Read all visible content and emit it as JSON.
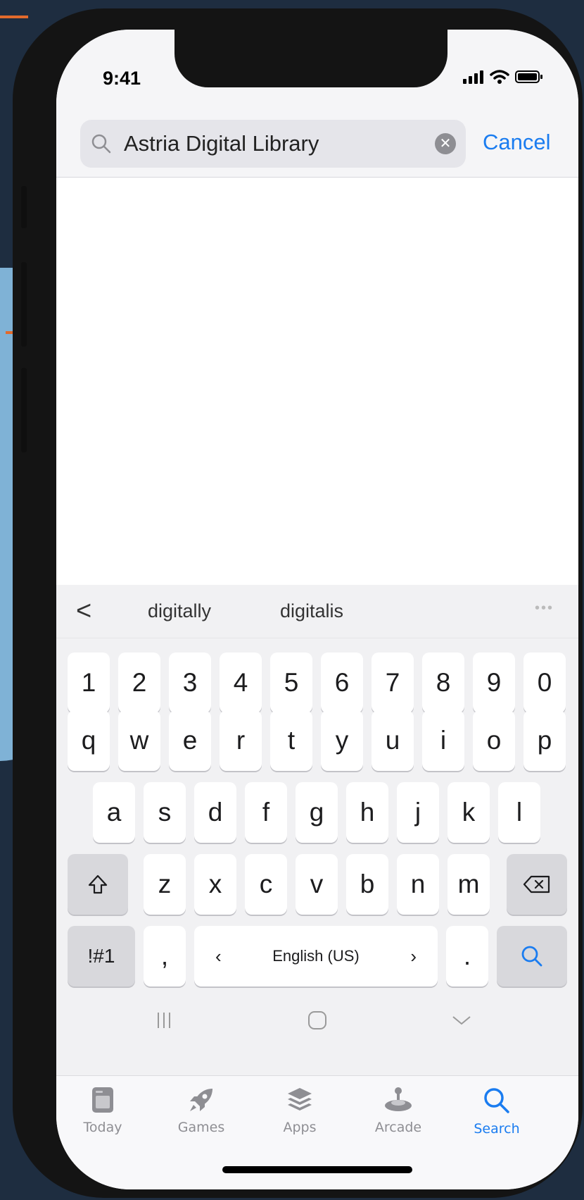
{
  "status": {
    "time": "9:41"
  },
  "search": {
    "query": "Astria Digital Library",
    "cancel_label": "Cancel"
  },
  "keyboard": {
    "suggestions": [
      "digitally",
      "digitalis"
    ],
    "number_row": [
      "1",
      "2",
      "3",
      "4",
      "5",
      "6",
      "7",
      "8",
      "9",
      "0"
    ],
    "row1": [
      "q",
      "w",
      "e",
      "r",
      "t",
      "y",
      "u",
      "i",
      "o",
      "p"
    ],
    "row2": [
      "a",
      "s",
      "d",
      "f",
      "g",
      "h",
      "j",
      "k",
      "l"
    ],
    "row3": [
      "z",
      "x",
      "c",
      "v",
      "b",
      "n",
      "m"
    ],
    "symbols_label": "!#1",
    "comma": ",",
    "period": ".",
    "language_label": "English (US)",
    "lang_prev": "‹",
    "lang_next": "›"
  },
  "tabs": [
    {
      "label": "Today",
      "icon": "today-icon"
    },
    {
      "label": "Games",
      "icon": "rocket-icon"
    },
    {
      "label": "Apps",
      "icon": "apps-stack-icon"
    },
    {
      "label": "Arcade",
      "icon": "joystick-icon"
    },
    {
      "label": "Search",
      "icon": "search-icon",
      "active": true
    }
  ],
  "colors": {
    "accent": "#1a7cf0",
    "keyboard_bg": "#f1f1f3",
    "key_bg": "#ffffff",
    "dark_key_bg": "#d8d8dc"
  }
}
